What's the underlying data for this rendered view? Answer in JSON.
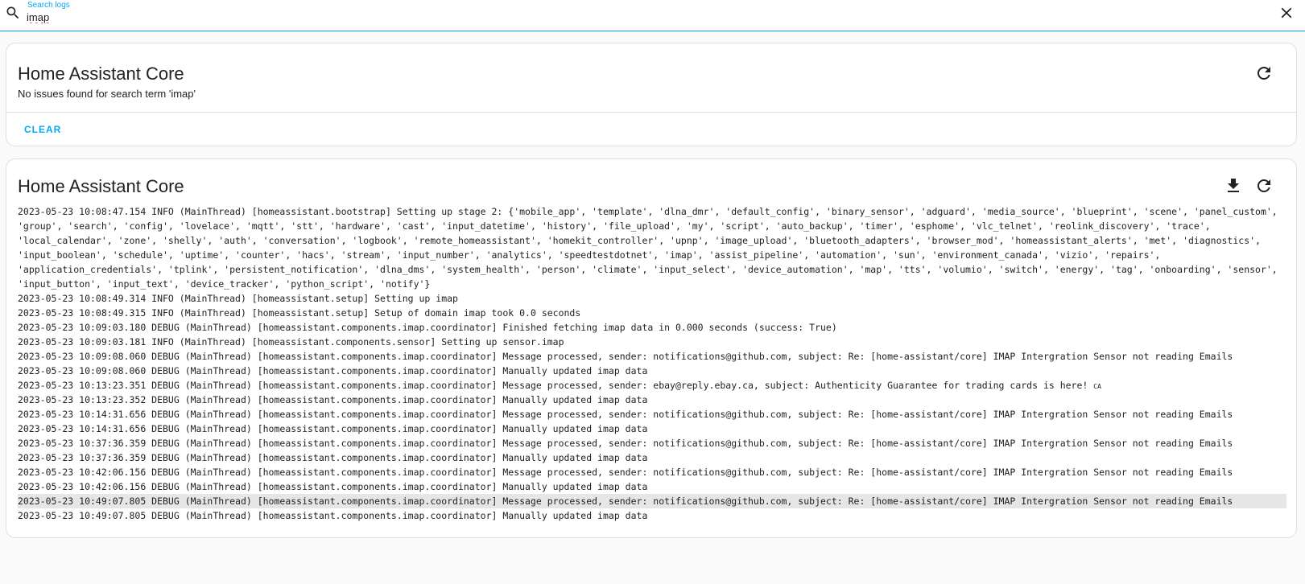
{
  "search": {
    "label": "Search logs",
    "value": "imap",
    "placeholder": ""
  },
  "search_icon": "magnify-icon",
  "close_icon": "close-icon",
  "issues_card": {
    "title": "Home Assistant Core",
    "subtitle": "No issues found for search term 'imap'",
    "clear_label": "CLEAR",
    "refresh_icon": "refresh-icon"
  },
  "log_card": {
    "title": "Home Assistant Core",
    "download_icon": "download-icon",
    "refresh_icon": "refresh-icon",
    "lines": [
      "2023-05-23 10:08:47.154 INFO (MainThread) [homeassistant.bootstrap] Setting up stage 2: {'mobile_app', 'template', 'dlna_dmr', 'default_config', 'binary_sensor', 'adguard', 'media_source', 'blueprint', 'scene', 'panel_custom', 'group', 'search', 'config', 'lovelace', 'mqtt', 'stt', 'hardware', 'cast', 'input_datetime', 'history', 'file_upload', 'my', 'script', 'auto_backup', 'timer', 'esphome', 'vlc_telnet', 'reolink_discovery', 'trace', 'local_calendar', 'zone', 'shelly', 'auth', 'conversation', 'logbook', 'remote_homeassistant', 'homekit_controller', 'upnp', 'image_upload', 'bluetooth_adapters', 'browser_mod', 'homeassistant_alerts', 'met', 'diagnostics', 'input_boolean', 'schedule', 'uptime', 'counter', 'hacs', 'stream', 'input_number', 'analytics', 'speedtestdotnet', 'imap', 'assist_pipeline', 'automation', 'sun', 'environment_canada', 'vizio', 'repairs', 'application_credentials', 'tplink', 'persistent_notification', 'dlna_dms', 'system_health', 'person', 'climate', 'input_select', 'device_automation', 'map', 'tts', 'volumio', 'switch', 'energy', 'tag', 'onboarding', 'sensor', 'input_button', 'input_text', 'device_tracker', 'python_script', 'notify'}",
      "2023-05-23 10:08:49.314 INFO (MainThread) [homeassistant.setup] Setting up imap",
      "2023-05-23 10:08:49.315 INFO (MainThread) [homeassistant.setup] Setup of domain imap took 0.0 seconds",
      "2023-05-23 10:09:03.180 DEBUG (MainThread) [homeassistant.components.imap.coordinator] Finished fetching imap data in 0.000 seconds (success: True)",
      "2023-05-23 10:09:03.181 INFO (MainThread) [homeassistant.components.sensor] Setting up sensor.imap",
      "2023-05-23 10:09:08.060 DEBUG (MainThread) [homeassistant.components.imap.coordinator] Message processed, sender: notifications@github.com, subject: Re: [home-assistant/core] IMAP Intergration Sensor not reading Emails",
      "2023-05-23 10:09:08.060 DEBUG (MainThread) [homeassistant.components.imap.coordinator] Manually updated imap data",
      "2023-05-23 10:13:23.351 DEBUG (MainThread) [homeassistant.components.imap.coordinator] Message processed, sender: ebay@reply.ebay.ca, subject: Authenticity Guarantee for trading cards is here! ",
      "2023-05-23 10:13:23.352 DEBUG (MainThread) [homeassistant.components.imap.coordinator] Manually updated imap data",
      "2023-05-23 10:14:31.656 DEBUG (MainThread) [homeassistant.components.imap.coordinator] Message processed, sender: notifications@github.com, subject: Re: [home-assistant/core] IMAP Intergration Sensor not reading Emails",
      "2023-05-23 10:14:31.656 DEBUG (MainThread) [homeassistant.components.imap.coordinator] Manually updated imap data",
      "2023-05-23 10:37:36.359 DEBUG (MainThread) [homeassistant.components.imap.coordinator] Message processed, sender: notifications@github.com, subject: Re: [home-assistant/core] IMAP Intergration Sensor not reading Emails",
      "2023-05-23 10:37:36.359 DEBUG (MainThread) [homeassistant.components.imap.coordinator] Manually updated imap data",
      "2023-05-23 10:42:06.156 DEBUG (MainThread) [homeassistant.components.imap.coordinator] Message processed, sender: notifications@github.com, subject: Re: [home-assistant/core] IMAP Intergration Sensor not reading Emails",
      "2023-05-23 10:42:06.156 DEBUG (MainThread) [homeassistant.components.imap.coordinator] Manually updated imap data",
      "2023-05-23 10:49:07.805 DEBUG (MainThread) [homeassistant.components.imap.coordinator] Message processed, sender: notifications@github.com, subject: Re: [home-assistant/core] IMAP Intergration Sensor not reading Emails",
      "2023-05-23 10:49:07.805 DEBUG (MainThread) [homeassistant.components.imap.coordinator] Manually updated imap data"
    ],
    "line_7_suffix": "CA",
    "highlighted_line": 15
  },
  "colors": {
    "accent": "#03a9f4",
    "text": "#212121",
    "highlight": "#e6e6e6"
  }
}
